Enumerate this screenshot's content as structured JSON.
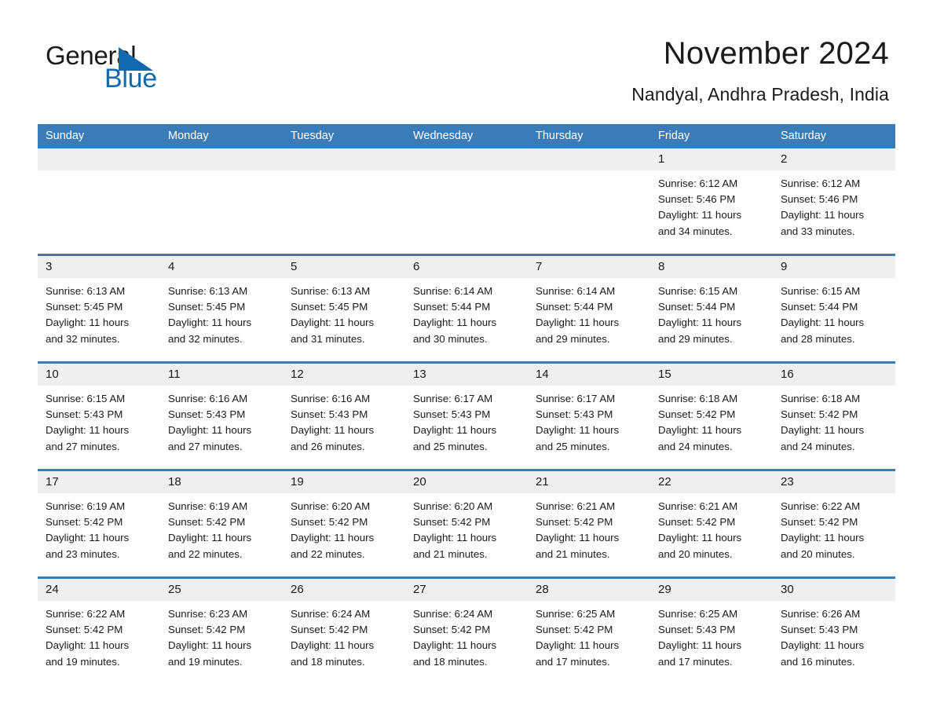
{
  "logo": {
    "word1": "General",
    "word2": "Blue",
    "triangle_color": "#1269b0",
    "text_color": "#1b1b1b"
  },
  "header": {
    "title": "November 2024",
    "subtitle": "Nandyal, Andhra Pradesh, India"
  },
  "theme": {
    "header_blue": "#3b7cb8",
    "daynum_gray": "#efefef",
    "cell_white": "#ffffff",
    "text": "#1a1a1a"
  },
  "weekdays": [
    "Sunday",
    "Monday",
    "Tuesday",
    "Wednesday",
    "Thursday",
    "Friday",
    "Saturday"
  ],
  "weeks": [
    [
      {
        "num": "",
        "lines": []
      },
      {
        "num": "",
        "lines": []
      },
      {
        "num": "",
        "lines": []
      },
      {
        "num": "",
        "lines": []
      },
      {
        "num": "",
        "lines": []
      },
      {
        "num": "1",
        "lines": [
          "Sunrise: 6:12 AM",
          "Sunset: 5:46 PM",
          "Daylight: 11 hours",
          "and 34 minutes."
        ]
      },
      {
        "num": "2",
        "lines": [
          "Sunrise: 6:12 AM",
          "Sunset: 5:46 PM",
          "Daylight: 11 hours",
          "and 33 minutes."
        ]
      }
    ],
    [
      {
        "num": "3",
        "lines": [
          "Sunrise: 6:13 AM",
          "Sunset: 5:45 PM",
          "Daylight: 11 hours",
          "and 32 minutes."
        ]
      },
      {
        "num": "4",
        "lines": [
          "Sunrise: 6:13 AM",
          "Sunset: 5:45 PM",
          "Daylight: 11 hours",
          "and 32 minutes."
        ]
      },
      {
        "num": "5",
        "lines": [
          "Sunrise: 6:13 AM",
          "Sunset: 5:45 PM",
          "Daylight: 11 hours",
          "and 31 minutes."
        ]
      },
      {
        "num": "6",
        "lines": [
          "Sunrise: 6:14 AM",
          "Sunset: 5:44 PM",
          "Daylight: 11 hours",
          "and 30 minutes."
        ]
      },
      {
        "num": "7",
        "lines": [
          "Sunrise: 6:14 AM",
          "Sunset: 5:44 PM",
          "Daylight: 11 hours",
          "and 29 minutes."
        ]
      },
      {
        "num": "8",
        "lines": [
          "Sunrise: 6:15 AM",
          "Sunset: 5:44 PM",
          "Daylight: 11 hours",
          "and 29 minutes."
        ]
      },
      {
        "num": "9",
        "lines": [
          "Sunrise: 6:15 AM",
          "Sunset: 5:44 PM",
          "Daylight: 11 hours",
          "and 28 minutes."
        ]
      }
    ],
    [
      {
        "num": "10",
        "lines": [
          "Sunrise: 6:15 AM",
          "Sunset: 5:43 PM",
          "Daylight: 11 hours",
          "and 27 minutes."
        ]
      },
      {
        "num": "11",
        "lines": [
          "Sunrise: 6:16 AM",
          "Sunset: 5:43 PM",
          "Daylight: 11 hours",
          "and 27 minutes."
        ]
      },
      {
        "num": "12",
        "lines": [
          "Sunrise: 6:16 AM",
          "Sunset: 5:43 PM",
          "Daylight: 11 hours",
          "and 26 minutes."
        ]
      },
      {
        "num": "13",
        "lines": [
          "Sunrise: 6:17 AM",
          "Sunset: 5:43 PM",
          "Daylight: 11 hours",
          "and 25 minutes."
        ]
      },
      {
        "num": "14",
        "lines": [
          "Sunrise: 6:17 AM",
          "Sunset: 5:43 PM",
          "Daylight: 11 hours",
          "and 25 minutes."
        ]
      },
      {
        "num": "15",
        "lines": [
          "Sunrise: 6:18 AM",
          "Sunset: 5:42 PM",
          "Daylight: 11 hours",
          "and 24 minutes."
        ]
      },
      {
        "num": "16",
        "lines": [
          "Sunrise: 6:18 AM",
          "Sunset: 5:42 PM",
          "Daylight: 11 hours",
          "and 24 minutes."
        ]
      }
    ],
    [
      {
        "num": "17",
        "lines": [
          "Sunrise: 6:19 AM",
          "Sunset: 5:42 PM",
          "Daylight: 11 hours",
          "and 23 minutes."
        ]
      },
      {
        "num": "18",
        "lines": [
          "Sunrise: 6:19 AM",
          "Sunset: 5:42 PM",
          "Daylight: 11 hours",
          "and 22 minutes."
        ]
      },
      {
        "num": "19",
        "lines": [
          "Sunrise: 6:20 AM",
          "Sunset: 5:42 PM",
          "Daylight: 11 hours",
          "and 22 minutes."
        ]
      },
      {
        "num": "20",
        "lines": [
          "Sunrise: 6:20 AM",
          "Sunset: 5:42 PM",
          "Daylight: 11 hours",
          "and 21 minutes."
        ]
      },
      {
        "num": "21",
        "lines": [
          "Sunrise: 6:21 AM",
          "Sunset: 5:42 PM",
          "Daylight: 11 hours",
          "and 21 minutes."
        ]
      },
      {
        "num": "22",
        "lines": [
          "Sunrise: 6:21 AM",
          "Sunset: 5:42 PM",
          "Daylight: 11 hours",
          "and 20 minutes."
        ]
      },
      {
        "num": "23",
        "lines": [
          "Sunrise: 6:22 AM",
          "Sunset: 5:42 PM",
          "Daylight: 11 hours",
          "and 20 minutes."
        ]
      }
    ],
    [
      {
        "num": "24",
        "lines": [
          "Sunrise: 6:22 AM",
          "Sunset: 5:42 PM",
          "Daylight: 11 hours",
          "and 19 minutes."
        ]
      },
      {
        "num": "25",
        "lines": [
          "Sunrise: 6:23 AM",
          "Sunset: 5:42 PM",
          "Daylight: 11 hours",
          "and 19 minutes."
        ]
      },
      {
        "num": "26",
        "lines": [
          "Sunrise: 6:24 AM",
          "Sunset: 5:42 PM",
          "Daylight: 11 hours",
          "and 18 minutes."
        ]
      },
      {
        "num": "27",
        "lines": [
          "Sunrise: 6:24 AM",
          "Sunset: 5:42 PM",
          "Daylight: 11 hours",
          "and 18 minutes."
        ]
      },
      {
        "num": "28",
        "lines": [
          "Sunrise: 6:25 AM",
          "Sunset: 5:42 PM",
          "Daylight: 11 hours",
          "and 17 minutes."
        ]
      },
      {
        "num": "29",
        "lines": [
          "Sunrise: 6:25 AM",
          "Sunset: 5:43 PM",
          "Daylight: 11 hours",
          "and 17 minutes."
        ]
      },
      {
        "num": "30",
        "lines": [
          "Sunrise: 6:26 AM",
          "Sunset: 5:43 PM",
          "Daylight: 11 hours",
          "and 16 minutes."
        ]
      }
    ]
  ]
}
